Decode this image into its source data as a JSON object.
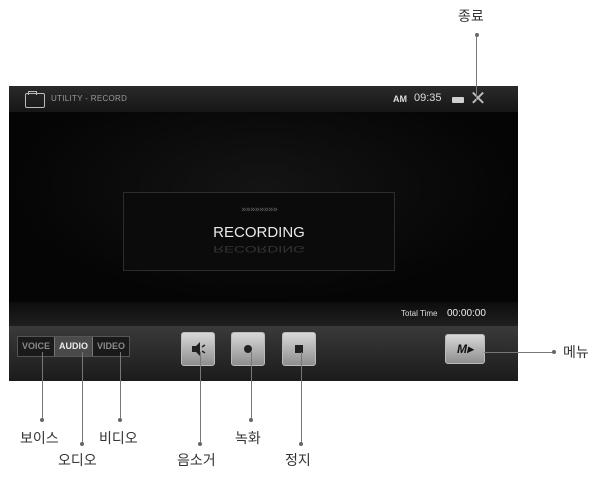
{
  "header": {
    "app_title": "UTILITY - RECORD",
    "ampm": "AM",
    "time": "09:35",
    "battery_icon": "battery-icon",
    "close_icon": "close-icon"
  },
  "display": {
    "arrows": "»»»»»»»»",
    "status": "RECORDING"
  },
  "time_bar": {
    "label": "Total Time",
    "value": "00:00:00"
  },
  "tabs": [
    {
      "label": "VOICE",
      "selected": false
    },
    {
      "label": "AUDIO",
      "selected": true
    },
    {
      "label": "VIDEO",
      "selected": false
    }
  ],
  "controls": {
    "mute_icon": "speaker-mute-icon",
    "record_icon": "record-icon",
    "stop_icon": "stop-icon",
    "menu_label": "M▸"
  },
  "callouts": {
    "close": "종료",
    "menu": "메뉴",
    "voice": "보이스",
    "video": "비디오",
    "record": "녹화",
    "audio": "오디오",
    "mute": "음소거",
    "stop": "정지"
  }
}
